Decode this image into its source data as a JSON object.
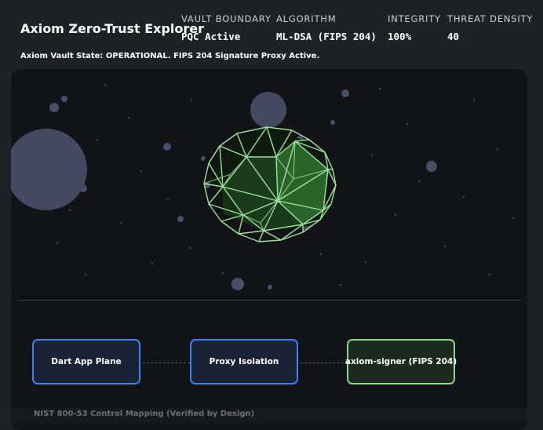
{
  "header": {
    "title": "Axiom Zero-Trust Explorer",
    "stats": [
      {
        "label": "VAULT BOUNDARY",
        "value": "PQC Active"
      },
      {
        "label": "ALGORITHM",
        "value": "ML-DSA (FIPS 204)"
      },
      {
        "label": "INTEGRITY",
        "value": "100%"
      },
      {
        "label": "THREAT DENSITY",
        "value": "40"
      }
    ],
    "status": "Axiom Vault State: OPERATIONAL. FIPS 204 Signature Proxy Active."
  },
  "flow": {
    "nodes": [
      {
        "label": "Dart App Plane"
      },
      {
        "label": "Proxy Isolation"
      },
      {
        "label": "axiom-signer (FIPS 204)"
      }
    ]
  },
  "footer": {
    "title": "NIST 800-53 Control Mapping (Verified by Design)"
  },
  "colors": {
    "background": "#202124",
    "panel": "#121316",
    "wireframe": "#9be39b",
    "core": "#2f6b2f",
    "threat": "#4a4e6a",
    "node_blue": "#3b82f6",
    "node_green": "#86d986"
  }
}
